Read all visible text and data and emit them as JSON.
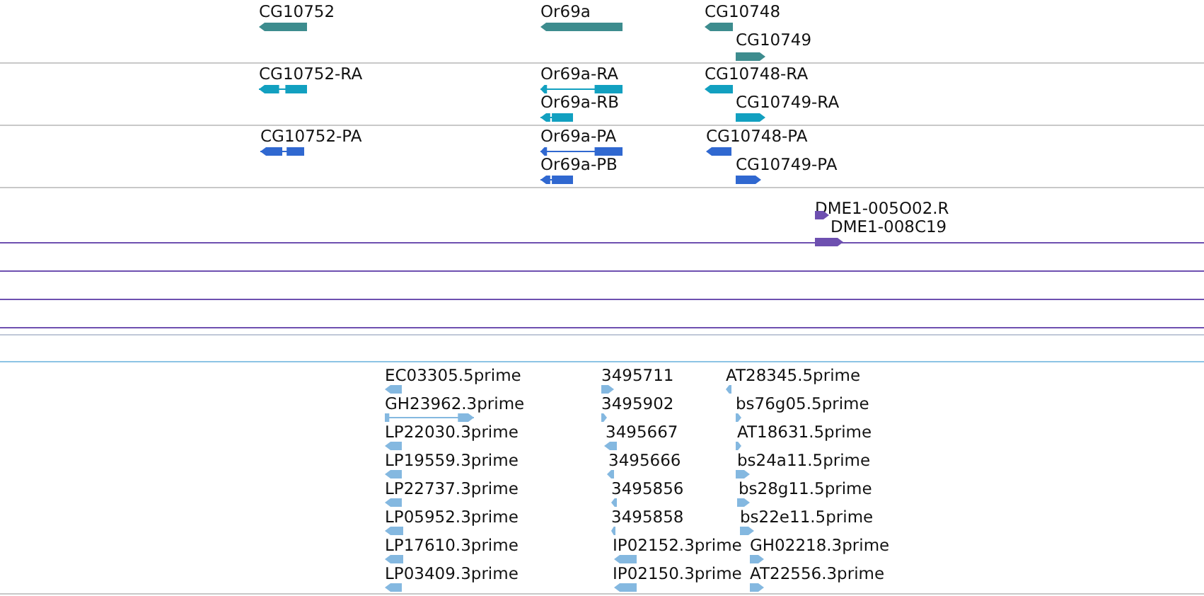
{
  "tracks": [
    {
      "kind": "gene",
      "color": "#3d8c8e",
      "features": [
        {
          "label": "CG10752",
          "reverse": true
        },
        {
          "label": "Or69a",
          "reverse": true
        },
        {
          "label": "CG10748",
          "reverse": true
        },
        {
          "label": "CG10749",
          "reverse": false
        }
      ]
    },
    {
      "kind": "transcript",
      "color": "#12a0c0",
      "features": [
        {
          "label": "CG10752-RA",
          "reverse": true
        },
        {
          "label": "Or69a-RA",
          "reverse": true
        },
        {
          "label": "Or69a-RB",
          "reverse": true
        },
        {
          "label": "CG10748-RA",
          "reverse": true
        },
        {
          "label": "CG10749-RA",
          "reverse": false
        }
      ]
    },
    {
      "kind": "protein",
      "color": "#3068d0",
      "features": [
        {
          "label": "CG10752-PA",
          "reverse": true
        },
        {
          "label": "Or69a-PA",
          "reverse": true
        },
        {
          "label": "Or69a-PB",
          "reverse": true
        },
        {
          "label": "CG10748-PA",
          "reverse": true
        },
        {
          "label": "CG10749-PA",
          "reverse": false
        }
      ]
    },
    {
      "kind": "alignment",
      "color": "#6e50b0",
      "features": [
        {
          "label": "DME1-005O02.R",
          "reverse": false
        },
        {
          "label": "DME1-008C19",
          "reverse": false
        }
      ]
    },
    {
      "kind": "est",
      "color": "#84b8e0",
      "features": [
        {
          "label": "EC03305.5prime",
          "reverse": true
        },
        {
          "label": "3495711",
          "reverse": false
        },
        {
          "label": "AT28345.5prime",
          "reverse": true
        },
        {
          "label": "GH23962.3prime",
          "reverse": false
        },
        {
          "label": "3495902",
          "reverse": false
        },
        {
          "label": "bs76g05.5prime",
          "reverse": false
        },
        {
          "label": "LP22030.3prime",
          "reverse": true
        },
        {
          "label": "3495667",
          "reverse": true
        },
        {
          "label": "AT18631.5prime",
          "reverse": false
        },
        {
          "label": "LP19559.3prime",
          "reverse": true
        },
        {
          "label": "3495666",
          "reverse": true
        },
        {
          "label": "bs24a11.5prime",
          "reverse": false
        },
        {
          "label": "LP22737.3prime",
          "reverse": true
        },
        {
          "label": "3495856",
          "reverse": true
        },
        {
          "label": "bs28g11.5prime",
          "reverse": false
        },
        {
          "label": "LP05952.3prime",
          "reverse": true
        },
        {
          "label": "3495858",
          "reverse": true
        },
        {
          "label": "bs22e11.5prime",
          "reverse": false
        },
        {
          "label": "LP17610.3prime",
          "reverse": true
        },
        {
          "label": "IP02152.3prime",
          "reverse": true
        },
        {
          "label": "GH02218.3prime",
          "reverse": false
        },
        {
          "label": "LP03409.3prime",
          "reverse": true
        },
        {
          "label": "IP02150.3prime",
          "reverse": true
        },
        {
          "label": "AT22556.3prime",
          "reverse": false
        }
      ]
    }
  ]
}
